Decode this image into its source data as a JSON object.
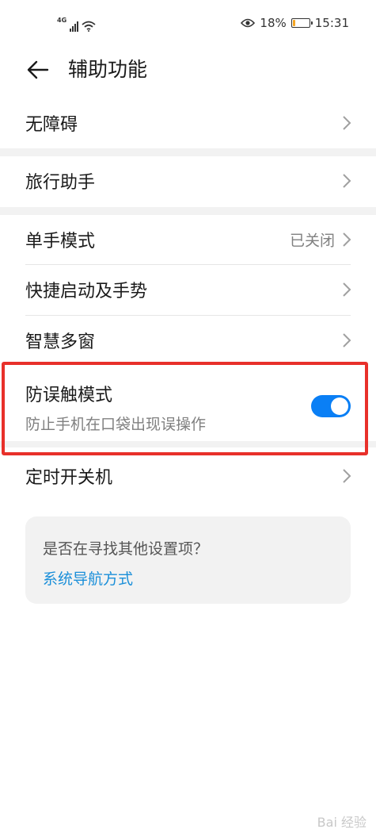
{
  "status_bar": {
    "network": "4G",
    "battery_percent": "18%",
    "battery_level": 0.18,
    "time": "15:31",
    "icons": [
      "signal-icon",
      "wifi-icon",
      "eye-icon",
      "battery-icon"
    ]
  },
  "header": {
    "title": "辅助功能",
    "back_icon": "arrow-left-icon"
  },
  "list": {
    "accessibility": "无障碍",
    "travel_assistant": "旅行助手",
    "one_hand_mode": "单手模式",
    "one_hand_mode_value": "已关闭",
    "quick_launch": "快捷启动及手势",
    "smart_multiwindow": "智慧多窗",
    "accidental_touch": "防误触模式",
    "accidental_touch_desc": "防止手机在口袋出现误操作",
    "accidental_touch_enabled": true,
    "scheduled_power": "定时开关机"
  },
  "suggestion": {
    "question": "是否在寻找其他设置项？",
    "link": "系统导航方式"
  },
  "watermark": "Bai 经验",
  "colors": {
    "accent": "#0a7ff5",
    "link": "#1a8fd9",
    "highlight": "#e8302a",
    "battery": "#f5a623"
  }
}
